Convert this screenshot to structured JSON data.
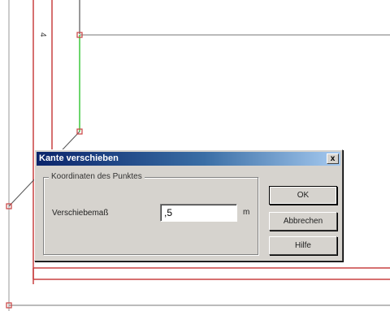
{
  "drawing": {
    "dimension_label": "4"
  },
  "dialog": {
    "title": "Kante verschieben",
    "close_label": "x",
    "group_title": "Koordinaten des Punktes",
    "field_label": "Verschiebemaß",
    "field_value": ",5",
    "unit": "m",
    "buttons": {
      "ok": "OK",
      "cancel": "Abbrechen",
      "help": "Hilfe"
    }
  }
}
